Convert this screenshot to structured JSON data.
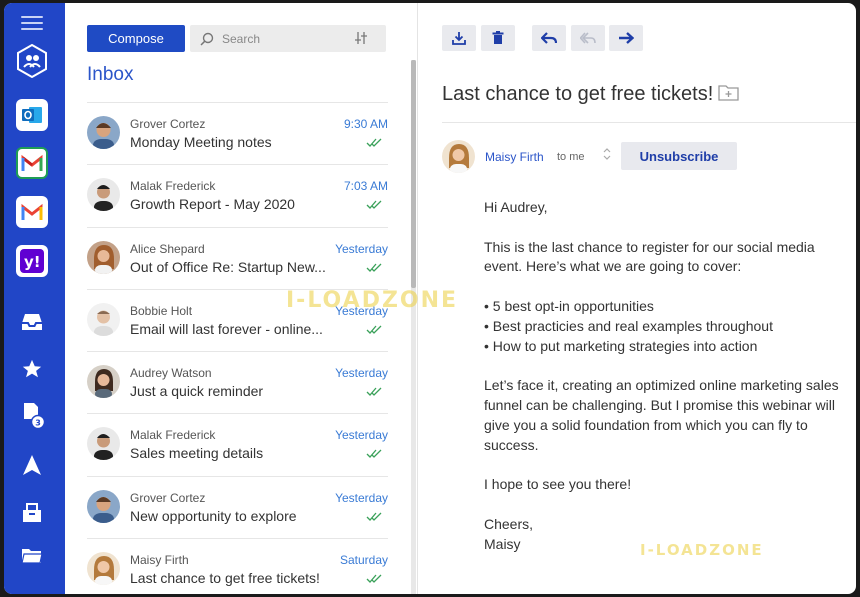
{
  "nav": {
    "accounts": [
      {
        "name": "team-accounts",
        "icon": "people-icon"
      },
      {
        "name": "outlook",
        "icon": "outlook-icon",
        "color": "#0f6cbd"
      },
      {
        "name": "gmail-1",
        "icon": "gmail-icon",
        "color": "#ea4335"
      },
      {
        "name": "gmail-2",
        "icon": "gmail-icon",
        "color": "#ea4335"
      },
      {
        "name": "yahoo",
        "icon": "yahoo-icon",
        "color": "#6001d2"
      }
    ],
    "folders": [
      {
        "name": "inbox",
        "icon": "inbox-tray-icon"
      },
      {
        "name": "starred",
        "icon": "star-icon"
      },
      {
        "name": "snoozed",
        "icon": "stack-icon",
        "badge": "3"
      },
      {
        "name": "sent",
        "icon": "send-icon"
      },
      {
        "name": "archive",
        "icon": "archive-box-icon"
      },
      {
        "name": "folders",
        "icon": "folder-icon"
      }
    ]
  },
  "toolbar": {
    "compose_label": "Compose",
    "search_placeholder": "Search"
  },
  "list": {
    "title": "Inbox",
    "messages": [
      {
        "from": "Grover Cortez",
        "subject": "Monday Meeting notes",
        "time": "9:30 AM"
      },
      {
        "from": "Malak Frederick",
        "subject": "Growth Report - May 2020",
        "time": "7:03 AM"
      },
      {
        "from": "Alice Shepard",
        "subject": "Out of Office Re: Startup New...",
        "time": "Yesterday"
      },
      {
        "from": "Bobbie Holt",
        "subject": "Email will last forever - online...",
        "time": "Yesterday"
      },
      {
        "from": "Audrey Watson",
        "subject": "Just a quick reminder",
        "time": "Yesterday"
      },
      {
        "from": "Malak Frederick",
        "subject": "Sales meeting details",
        "time": "Yesterday"
      },
      {
        "from": "Grover Cortez",
        "subject": "New opportunity to explore",
        "time": "Yesterday"
      },
      {
        "from": "Maisy Firth",
        "subject": "Last chance to get free tickets!",
        "time": "Saturday"
      }
    ]
  },
  "reader": {
    "subject": "Last chance to get free tickets!",
    "sender": "Maisy Firth",
    "to_label": "to me",
    "unsubscribe_label": "Unsubscribe",
    "greeting": "Hi Audrey,",
    "intro": "This is the last chance to register for our social media event. Here’s what we are going to cover:",
    "bullets": [
      "5 best opt-in opportunities",
      "Best practicies and real examples throughout",
      "How to put marketing strategies into action"
    ],
    "para2": "Let’s face it, creating an optimized online marketing sales funnel can be challenging. But I promise this webinar will give you a solid foundation from which you can fly to success.",
    "para3": "I hope to see you there!",
    "closing": "Cheers,",
    "signature": "Maisy"
  },
  "watermark": "I-LOADZONE"
}
